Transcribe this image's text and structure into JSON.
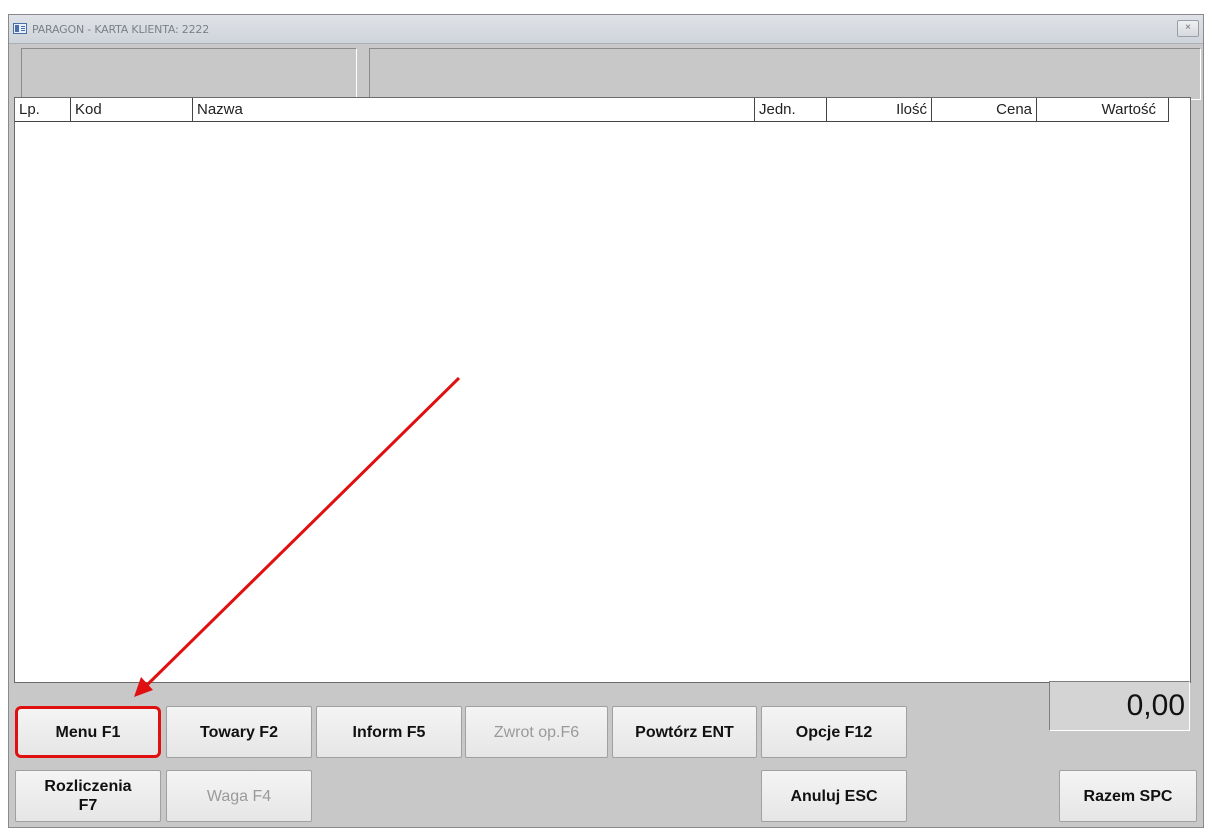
{
  "window": {
    "title": "PARAGON - KARTA KLIENTA: 2222",
    "close_icon": "×"
  },
  "grid": {
    "columns": [
      {
        "key": "lp",
        "label": "Lp."
      },
      {
        "key": "kod",
        "label": "Kod"
      },
      {
        "key": "nazwa",
        "label": "Nazwa"
      },
      {
        "key": "jedn",
        "label": "Jedn."
      },
      {
        "key": "ilosc",
        "label": "Ilość"
      },
      {
        "key": "cena",
        "label": "Cena"
      },
      {
        "key": "wartosc",
        "label": "Wartość"
      }
    ],
    "rows": []
  },
  "buttons": {
    "menu": "Menu F1",
    "towary": "Towary F2",
    "inform": "Inform F5",
    "zwrot": "Zwrot op.F6",
    "powtorz": "Powtórz ENT",
    "opcje": "Opcje F12",
    "rozliczenia_1": "Rozliczenia",
    "rozliczenia_2": "F7",
    "waga": "Waga F4",
    "anuluj": "Anuluj ESC",
    "razem": "Razem SPC"
  },
  "total": "0,00",
  "colors": {
    "highlight": "#e01010",
    "window_bg": "#c8c8c8"
  }
}
